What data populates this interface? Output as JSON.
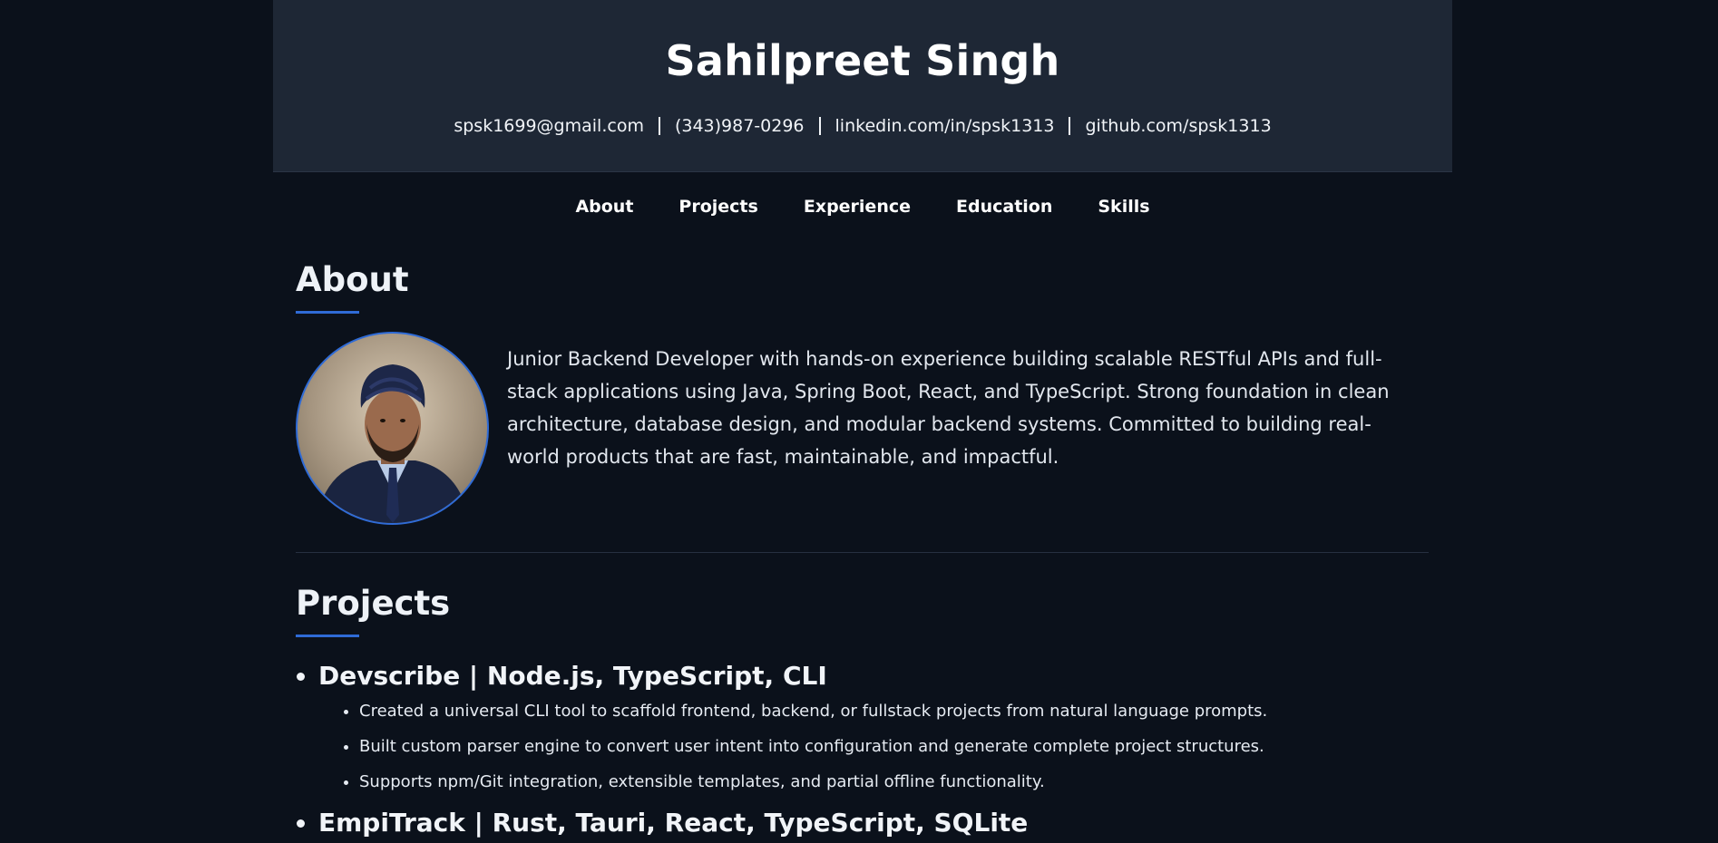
{
  "header": {
    "name": "Sahilpreet Singh",
    "contacts": [
      "spsk1699@gmail.com",
      "(343)987-0296",
      "linkedin.com/in/spsk1313",
      "github.com/spsk1313"
    ]
  },
  "nav": [
    "About",
    "Projects",
    "Experience",
    "Education",
    "Skills"
  ],
  "about": {
    "title": "About",
    "text": "Junior Backend Developer with hands-on experience building scalable RESTful APIs and full-stack applications using Java, Spring Boot, React, and TypeScript. Strong foundation in clean architecture, database design, and modular backend systems. Committed to building real-world products that are fast, maintainable, and impactful."
  },
  "projects": {
    "title": "Projects",
    "items": [
      {
        "name": "Devscribe | Node.js, TypeScript, CLI",
        "bullets": [
          "Created a universal CLI tool to scaffold frontend, backend, or fullstack projects from natural language prompts.",
          "Built custom parser engine to convert user intent into configuration and generate complete project structures.",
          "Supports npm/Git integration, extensible templates, and partial offline functionality."
        ]
      },
      {
        "name": "EmpiTrack | Rust, Tauri, React, TypeScript, SQLite",
        "bullets": []
      }
    ]
  },
  "colors": {
    "background": "#0b111b",
    "header_bg": "#1e2735",
    "accent": "#2f6bd6"
  }
}
